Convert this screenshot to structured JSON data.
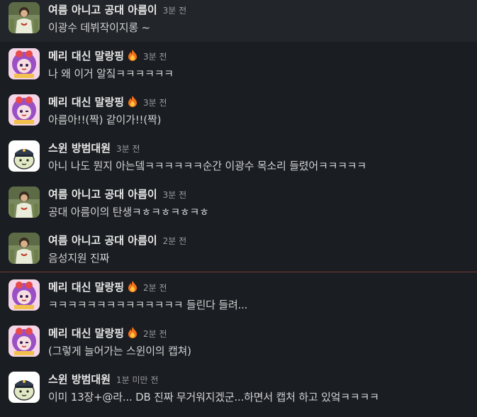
{
  "messages": [
    {
      "sender": "여름 아니고 공대 아름이",
      "fire": false,
      "time": "3분 전",
      "text": "이광수 데뷔작이지롱 ~",
      "avatar": "photo-avatar"
    },
    {
      "sender": "메리 대신 말랑핑",
      "fire": true,
      "time": "3분 전",
      "text": "나 왜 이거 알짘ㅋㅋㅋㅋㅋㅋ",
      "avatar": "purple-character-avatar"
    },
    {
      "sender": "메리 대신 말랑핑",
      "fire": true,
      "time": "3분 전",
      "text": "아름아!!(짝) 같이가!!(짝)",
      "avatar": "purple-character-avatar"
    },
    {
      "sender": "스윈 방범대원",
      "fire": false,
      "time": "3분 전",
      "text": "아니 나도 뭔지 아는뎈ㅋㅋㅋㅋㅋㅋ순간 이광수 목소리 들렸어ㅋㅋㅋㅋㅋ",
      "avatar": "police-character-avatar"
    },
    {
      "sender": "여름 아니고 공대 아름이",
      "fire": false,
      "time": "3분 전",
      "text": "공대 아름이의 탄생ㅋㅎㅋㅎㅋㅎㅋㅎ",
      "avatar": "photo-avatar"
    },
    {
      "sender": "여름 아니고 공대 아름이",
      "fire": false,
      "time": "2분 전",
      "text": "음성지원 진짜",
      "avatar": "photo-avatar"
    },
    {
      "sender": "메리 대신 말랑핑",
      "fire": true,
      "time": "2분 전",
      "text": "ㅋㅋㅋㅋㅋㅋㅋㅋㅋㅋㅋㅋㅋㅋ 들린다 들려...",
      "avatar": "purple-character-avatar"
    },
    {
      "sender": "메리 대신 말랑핑",
      "fire": true,
      "time": "2분 전",
      "text": "(그렇게 늘어가는 스윈이의 캡쳐)",
      "avatar": "purple-character-avatar"
    },
    {
      "sender": "스윈 방범대원",
      "fire": false,
      "time": "1분 미만 전",
      "text": "이미 13장+@라... DB 진짜 무거워지겠군...하면서 캡처 하고 있엌ㅋㅋㅋㅋ",
      "avatar": "police-character-avatar"
    }
  ],
  "colors": {
    "background": "#1a1d21",
    "hover": "#222529",
    "divider": "#7a3a33"
  },
  "fire_icon": "fire-icon"
}
